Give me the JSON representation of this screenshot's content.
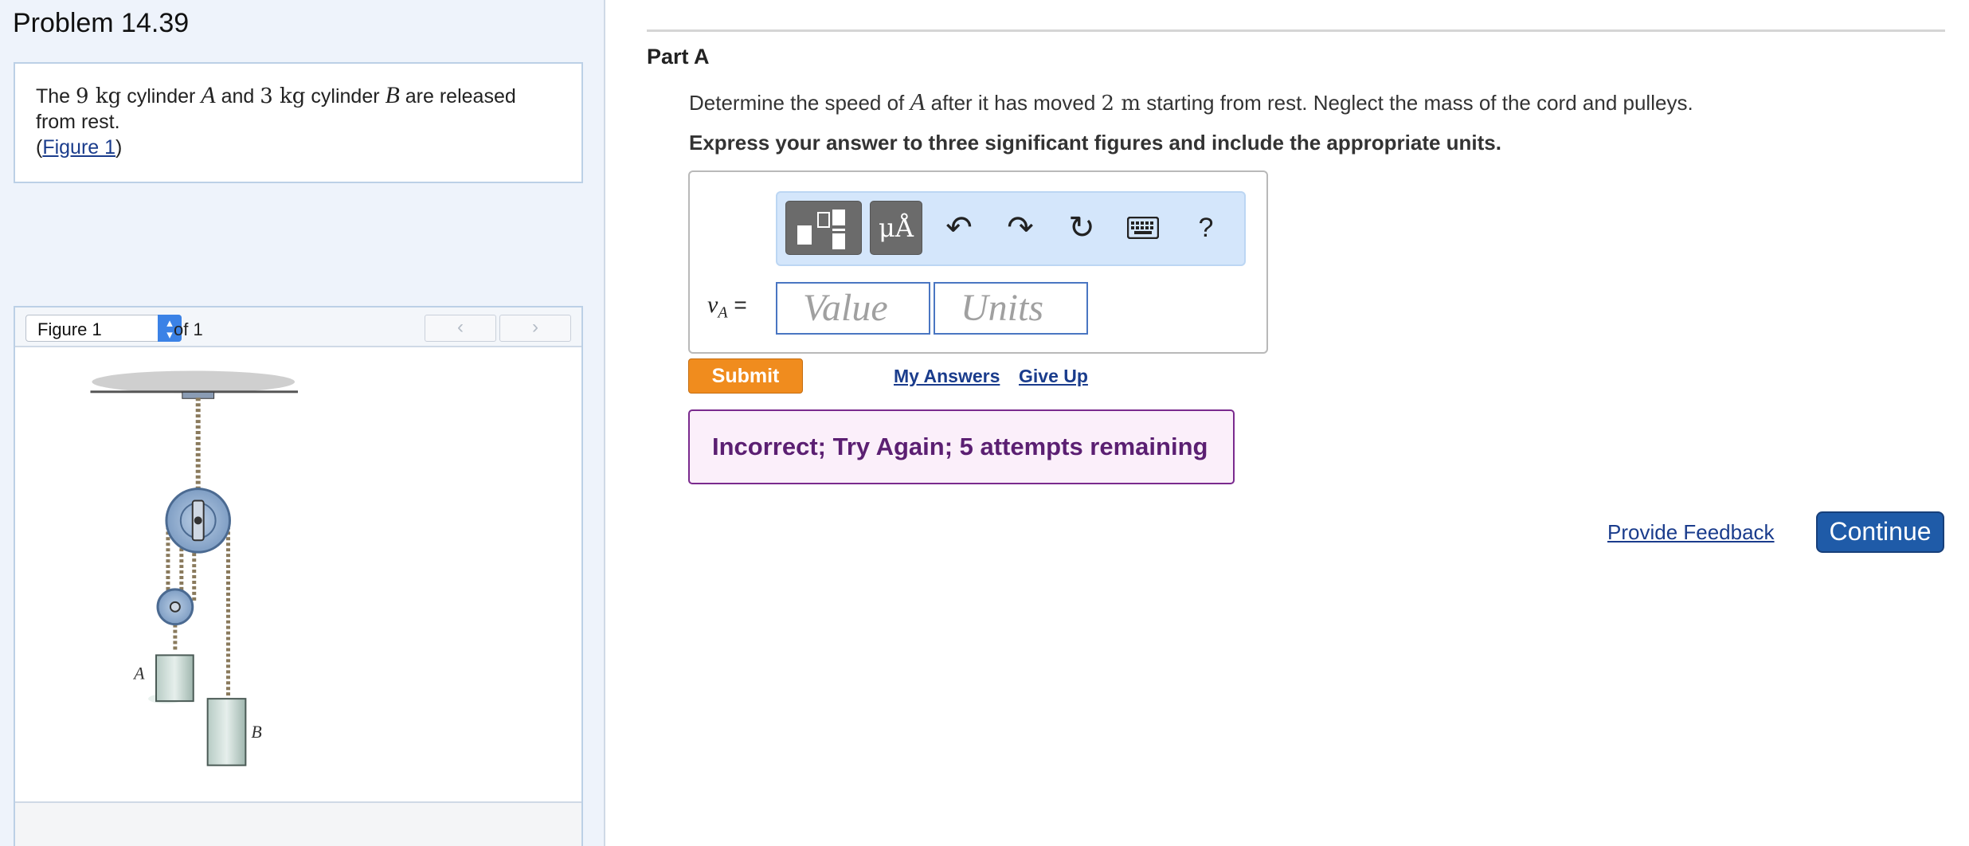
{
  "problem": {
    "title": "Problem 14.39",
    "statement": {
      "t1": "The ",
      "m1": "9 kg",
      "t2": " cylinder ",
      "v1": "A",
      "t3": " and ",
      "m2": "3 kg",
      "t4": " cylinder ",
      "v2": "B",
      "t5": " are released",
      "t6": "from rest.",
      "fig_open": "(",
      "fig_link": "Figure 1",
      "fig_close": ")"
    }
  },
  "figure": {
    "selected": "Figure 1",
    "of_label": "of 1",
    "prev_icon": "chevron-left-icon",
    "next_icon": "chevron-right-icon",
    "label_a": "A",
    "label_b": "B"
  },
  "part": {
    "title": "Part A",
    "question": {
      "t1": "Determine the speed of ",
      "v1": "A",
      "t2": " after it has moved ",
      "m1": "2 m",
      "t3": " starting from rest. Neglect the mass of the cord and pulleys."
    },
    "instruction": "Express your answer to three significant figures and include the appropriate units."
  },
  "toolbar": {
    "templates_icon": "templates-icon",
    "units_symbol": "μÅ",
    "undo_icon": "undo-icon",
    "redo_icon": "redo-icon",
    "reset_icon": "reset-icon",
    "keyboard_icon": "keyboard-icon",
    "help_label": "?"
  },
  "answer": {
    "var": "v",
    "sub": "A",
    "equals": "=",
    "value_placeholder": "Value",
    "units_placeholder": "Units"
  },
  "actions": {
    "submit": "Submit",
    "my_answers": "My Answers",
    "give_up": "Give Up",
    "feedback": "Incorrect; Try Again; 5 attempts remaining",
    "provide_feedback": "Provide Feedback",
    "continue": "Continue"
  },
  "colors": {
    "accent_orange": "#f08c1e",
    "link_blue": "#1a3c8c",
    "continue_blue": "#1f5ba8",
    "feedback_purple": "#5b1f72"
  }
}
